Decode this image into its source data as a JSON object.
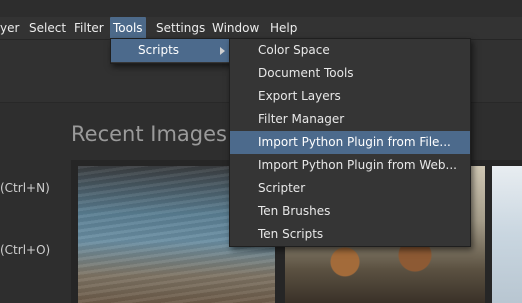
{
  "menubar": {
    "items": [
      {
        "label": "yer"
      },
      {
        "label": "Select"
      },
      {
        "label": "Filter"
      },
      {
        "label": "Tools"
      },
      {
        "label": "Settings"
      },
      {
        "label": "Window"
      },
      {
        "label": "Help"
      }
    ]
  },
  "welcome": {
    "recent_title": "Recent Images",
    "new_shortcut": "(Ctrl+N)",
    "open_shortcut": "(Ctrl+O)"
  },
  "tools_menu": {
    "items": [
      {
        "label": "Scripts",
        "submenu": true
      }
    ]
  },
  "scripts_menu": {
    "items": [
      {
        "label": "Color Space"
      },
      {
        "label": "Document Tools"
      },
      {
        "label": "Export Layers"
      },
      {
        "label": "Filter Manager"
      },
      {
        "label": "Import Python Plugin from File...",
        "highlighted": true
      },
      {
        "label": "Import Python Plugin from Web..."
      },
      {
        "label": "Scripter"
      },
      {
        "label": "Ten Brushes"
      },
      {
        "label": "Ten Scripts"
      }
    ]
  },
  "colors": {
    "highlight": "#4c6a8c",
    "menu_bg": "#353535",
    "window_bg": "#2f2f2f"
  }
}
